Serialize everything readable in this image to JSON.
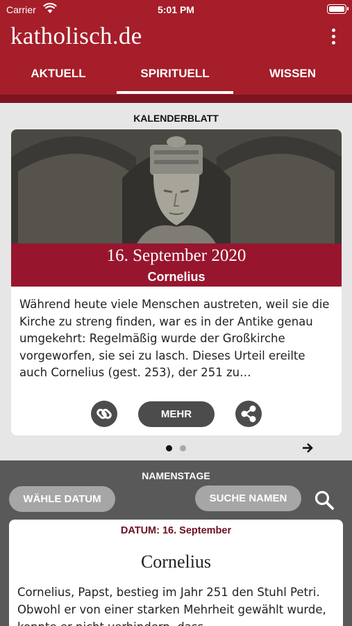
{
  "status_bar": {
    "carrier": "Carrier",
    "time": "5:01 PM"
  },
  "header": {
    "brand": "katholisch.de",
    "tabs": [
      {
        "label": "AKTUELL"
      },
      {
        "label": "SPIRITUELL",
        "active": true
      },
      {
        "label": "WISSEN"
      }
    ]
  },
  "kalenderblatt": {
    "section_title": "KALENDERBLATT",
    "date": "16. September 2020",
    "name": "Cornelius",
    "text": "Während heute viele Menschen austreten, weil sie die Kirche zu streng finden, war es in der Antike genau umgekehrt: Regelmäßig wurde der Großkirche vorgeworfen, sie sei zu lasch. Dieses Urteil ereilte auch Cornelius (gest. 253), der 251 zu…",
    "more_label": "MEHR",
    "pager": {
      "count": 2,
      "current": 1
    },
    "icons": {
      "link": "link-icon",
      "share": "share-icon",
      "next": "arrow-right-icon"
    }
  },
  "namenstage": {
    "section_title": "NAMENSTAGE",
    "choose_date_label": "WÄHLE DATUM",
    "search_names_label": "SUCHE NAMEN",
    "datum_label": "DATUM: 16. September",
    "name": "Cornelius",
    "text": "Cornelius, Papst, bestieg im Jahr 251 den Stuhl Petri. Obwohl er von einer starken Mehrheit gewählt wurde, konnte er nicht verhindern, dass"
  },
  "colors": {
    "brand": "#a51e2a",
    "banner": "#97162e",
    "dark_section": "#595959",
    "button_dark": "#4c4c4c",
    "button_gray": "#a6a6a6"
  }
}
